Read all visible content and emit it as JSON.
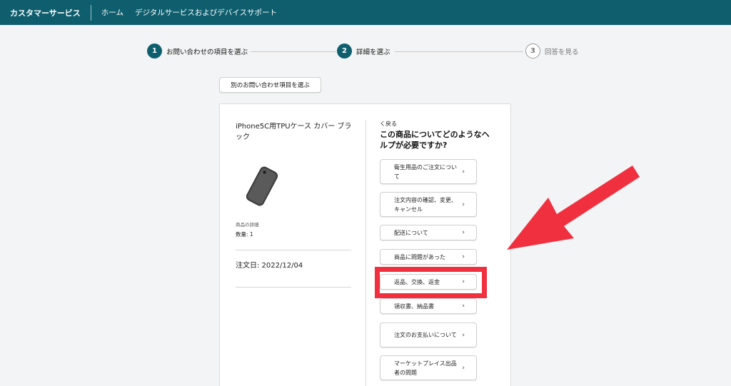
{
  "header": {
    "brand": "カスタマーサービス",
    "nav": [
      "ホーム",
      "デジタルサービスおよびデバイスサポート"
    ]
  },
  "steps": [
    {
      "num": "1",
      "label": "お問い合わせの項目を選ぶ",
      "state": "active"
    },
    {
      "num": "2",
      "label": "詳細を選ぶ",
      "state": "active"
    },
    {
      "num": "3",
      "label": "回答を見る",
      "state": "inactive"
    }
  ],
  "other_button": "別のお問い合わせ項目を選ぶ",
  "product": {
    "title": "iPhone5C用TPUケース カバー ブラック",
    "detail_label": "商品の詳細",
    "quantity": "数量: 1",
    "order_date": "注文日: 2022/12/04"
  },
  "help": {
    "back": "く戻る",
    "question": "この商品についてどのようなヘルプが必要ですか?",
    "options": [
      "衛生用品のご注文について",
      "注文内容の確認、変更、キャンセル",
      "配送について",
      "商品に問題があった",
      "返品、交換、返金",
      "領収書、納品書",
      "注文のお支払いについて",
      "マーケットプレイス出品者の問題"
    ]
  },
  "colors": {
    "header": "#0f5e6e",
    "highlight": "#f0303f"
  }
}
